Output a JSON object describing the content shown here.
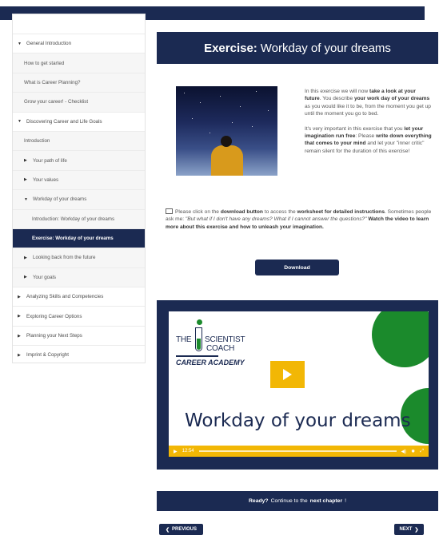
{
  "sidebar": {
    "items": [
      {
        "label": "General Introduction",
        "icon": "caret-down-icon"
      },
      {
        "label": "How to get started"
      },
      {
        "label": "What is Career Planning?"
      },
      {
        "label": "Grow your career! - Checklist"
      },
      {
        "label": "Discovering Career and Life Goals",
        "icon": "caret-down-icon"
      },
      {
        "label": "Introduction"
      },
      {
        "label": "Your path of life",
        "icon": "caret-right-icon"
      },
      {
        "label": "Your values",
        "icon": "caret-right-icon"
      },
      {
        "label": "Workday of your dreams",
        "icon": "caret-down-icon"
      },
      {
        "label": "Introduction: Workday of your dreams"
      },
      {
        "label": "Exercise: Workday of your dreams"
      },
      {
        "label": "Looking back from the future",
        "icon": "caret-right-icon"
      },
      {
        "label": "Your goals",
        "icon": "caret-right-icon"
      },
      {
        "label": "Analyzing Skills and Competencies",
        "icon": "caret-right-icon"
      },
      {
        "label": "Exploring Career Options",
        "icon": "caret-right-icon"
      },
      {
        "label": "Planning your Next Steps",
        "icon": "caret-right-icon"
      },
      {
        "label": "Imprint & Copyright",
        "icon": "caret-right-icon"
      }
    ]
  },
  "header": {
    "title_bold": "Exercise:",
    "title_rest": "Workday of your dreams"
  },
  "intro": {
    "p1_a": "In this exercise we will now ",
    "p1_b": "take a look at your future",
    "p1_c": ". You describe ",
    "p1_d": "your work day of your dreams",
    "p1_e": " as you would like it to be, from the moment you get up until the moment you go to bed.",
    "p2_a": "It's very important in this exercise that you ",
    "p2_b": "let your imagination run free",
    "p2_c": ": Please ",
    "p2_d": "write down everything that comes to your mind",
    "p2_e": " and let your \"inner critic\" remain silent for the duration of this exercise!"
  },
  "instructions": {
    "a": "Please click on the ",
    "b": "download button",
    "c": " to access the ",
    "d": "worksheet for detailed instructions",
    "e": ". Sometimes people ask me: ",
    "f": "\"But what if I don't have any dreams? What if I cannot answer the questions?\"",
    "g": " Watch the video to learn more about this exercise and how to unleash your imagination."
  },
  "download_label": "Download",
  "video": {
    "logo_the": "THE",
    "logo_scientist": "SCIENTIST",
    "logo_coach": "COACH",
    "logo_academy": "CAREER ACADEMY",
    "title": "Workday of your dreams",
    "time": "12:54"
  },
  "ready": {
    "a": "Ready?",
    "b": " Continue to the ",
    "c": "next chapter",
    "d": "!"
  },
  "nav": {
    "prev": "PREVIOUS",
    "next": "NEXT"
  },
  "colors": {
    "navy": "#1b2a52",
    "yellow": "#f2b705",
    "green": "#1b8a2c"
  }
}
